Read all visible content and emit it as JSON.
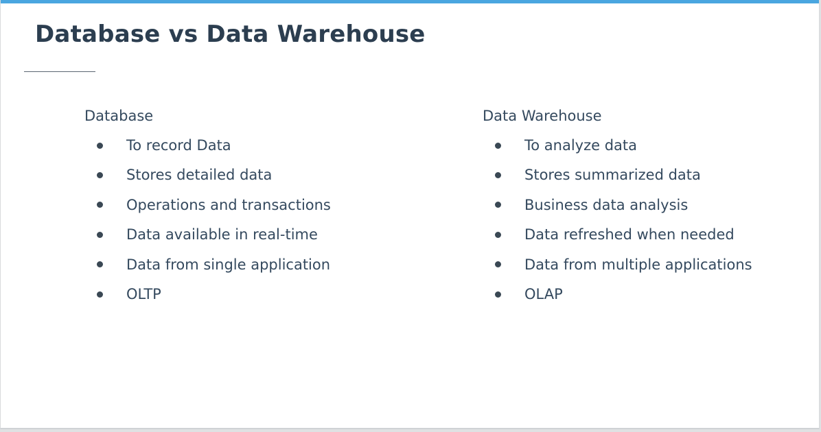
{
  "slide": {
    "title": "Database vs Data Warehouse",
    "accent_color": "#4aa6e0"
  },
  "columns": {
    "database": {
      "heading": "Database",
      "items": [
        "To record Data",
        "Stores detailed data",
        "Operations and transactions",
        "Data available in real-time",
        "Data from single application",
        "OLTP"
      ]
    },
    "warehouse": {
      "heading": "Data Warehouse",
      "items": [
        "To analyze data",
        "Stores summarized data",
        "Business data analysis",
        "Data refreshed when needed",
        "Data from multiple applications",
        "OLAP"
      ]
    }
  }
}
